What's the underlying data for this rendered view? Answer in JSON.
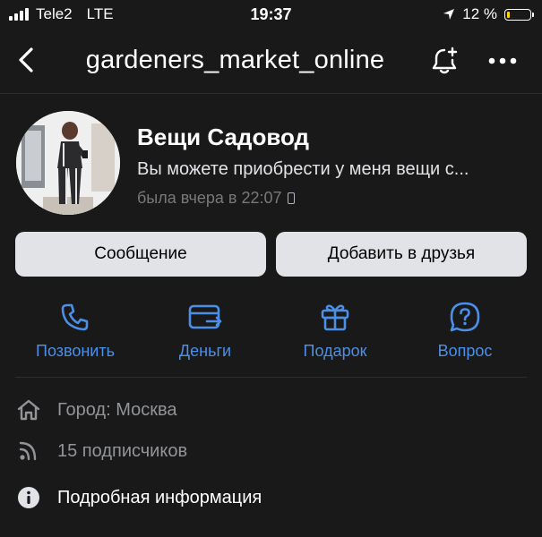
{
  "status_bar": {
    "carrier": "Tele2",
    "network": "LTE",
    "time": "19:37",
    "battery_text": "12 %",
    "battery_level": 0.12
  },
  "nav": {
    "title": "gardeners_market_online"
  },
  "profile": {
    "name": "Вещи Садовод",
    "status": "Вы можете приобрести у меня вещи с...",
    "last_seen": "была вчера в 22:07"
  },
  "buttons": {
    "message": "Сообщение",
    "add_friend": "Добавить в друзья"
  },
  "actions": [
    {
      "label": "Позвонить",
      "icon": "phone-icon"
    },
    {
      "label": "Деньги",
      "icon": "money-card-icon"
    },
    {
      "label": "Подарок",
      "icon": "gift-icon"
    },
    {
      "label": "Вопрос",
      "icon": "question-icon"
    }
  ],
  "info": {
    "city": "Город: Москва",
    "subscribers": "15 подписчиков",
    "details": "Подробная информация"
  },
  "colors": {
    "background": "#19191a",
    "accent": "#4c8fe6",
    "button_bg": "#e1e3e6",
    "secondary_text": "#929497"
  }
}
